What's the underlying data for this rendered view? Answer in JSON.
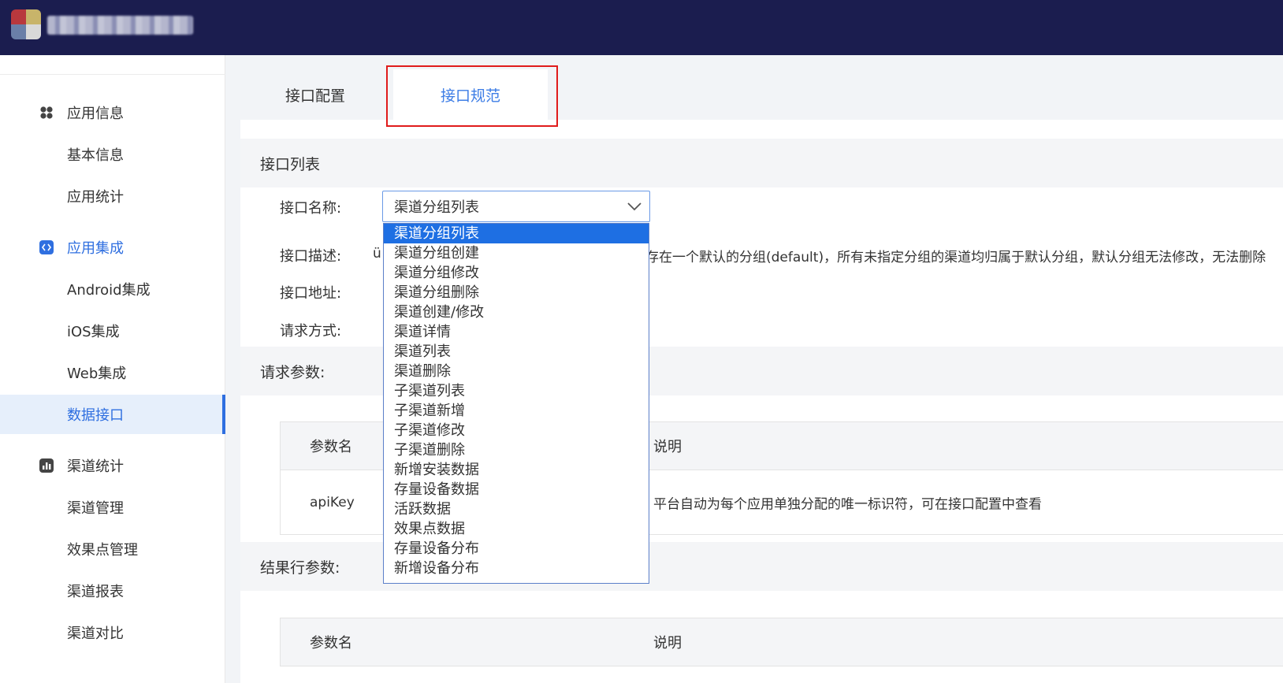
{
  "sidebar": {
    "items": [
      {
        "label": "应用信息",
        "icon": "apps-grid-icon"
      },
      {
        "label": "基本信息"
      },
      {
        "label": "应用统计"
      },
      {
        "label": "应用集成",
        "icon": "code-icon"
      },
      {
        "label": "Android集成"
      },
      {
        "label": "iOS集成"
      },
      {
        "label": "Web集成"
      },
      {
        "label": "数据接口"
      },
      {
        "label": "渠道统计",
        "icon": "bar-chart-icon"
      },
      {
        "label": "渠道管理"
      },
      {
        "label": "效果点管理"
      },
      {
        "label": "渠道报表"
      },
      {
        "label": "渠道对比"
      }
    ]
  },
  "tabs": [
    {
      "label": "接口配置"
    },
    {
      "label": "接口规范"
    }
  ],
  "interface_list": {
    "title": "接口列表",
    "name_label": "接口名称:",
    "selected": "渠道分组列表",
    "desc_label": "接口描述:",
    "desc_prefix": "ü",
    "desc_visible": "存在一个默认的分组(default)，所有未指定分组的渠道均归属于默认分组，默认分组无法修改，无法删除",
    "url_label": "接口地址:",
    "method_label": "请求方式:"
  },
  "dropdown": {
    "options": [
      "渠道分组列表",
      "渠道分组创建",
      "渠道分组修改",
      "渠道分组删除",
      "渠道创建/修改",
      "渠道详情",
      "渠道列表",
      "渠道删除",
      "子渠道列表",
      "子渠道新增",
      "子渠道修改",
      "子渠道删除",
      "新增安装数据",
      "存量设备数据",
      "活跃数据",
      "效果点数据",
      "存量设备分布",
      "新增设备分布"
    ]
  },
  "request_params": {
    "title": "请求参数:",
    "col_name": "参数名",
    "col_desc": "说明",
    "rows": [
      {
        "name": "apiKey",
        "desc": "平台自动为每个应用单独分配的唯一标识符，可在接口配置中查看"
      }
    ]
  },
  "result_params": {
    "title": "结果行参数:",
    "col_name": "参数名",
    "col_desc": "说明"
  },
  "colors": {
    "topbar": "#1b1d4f",
    "accent": "#2f6fe0",
    "highlight": "#e01b1b"
  }
}
